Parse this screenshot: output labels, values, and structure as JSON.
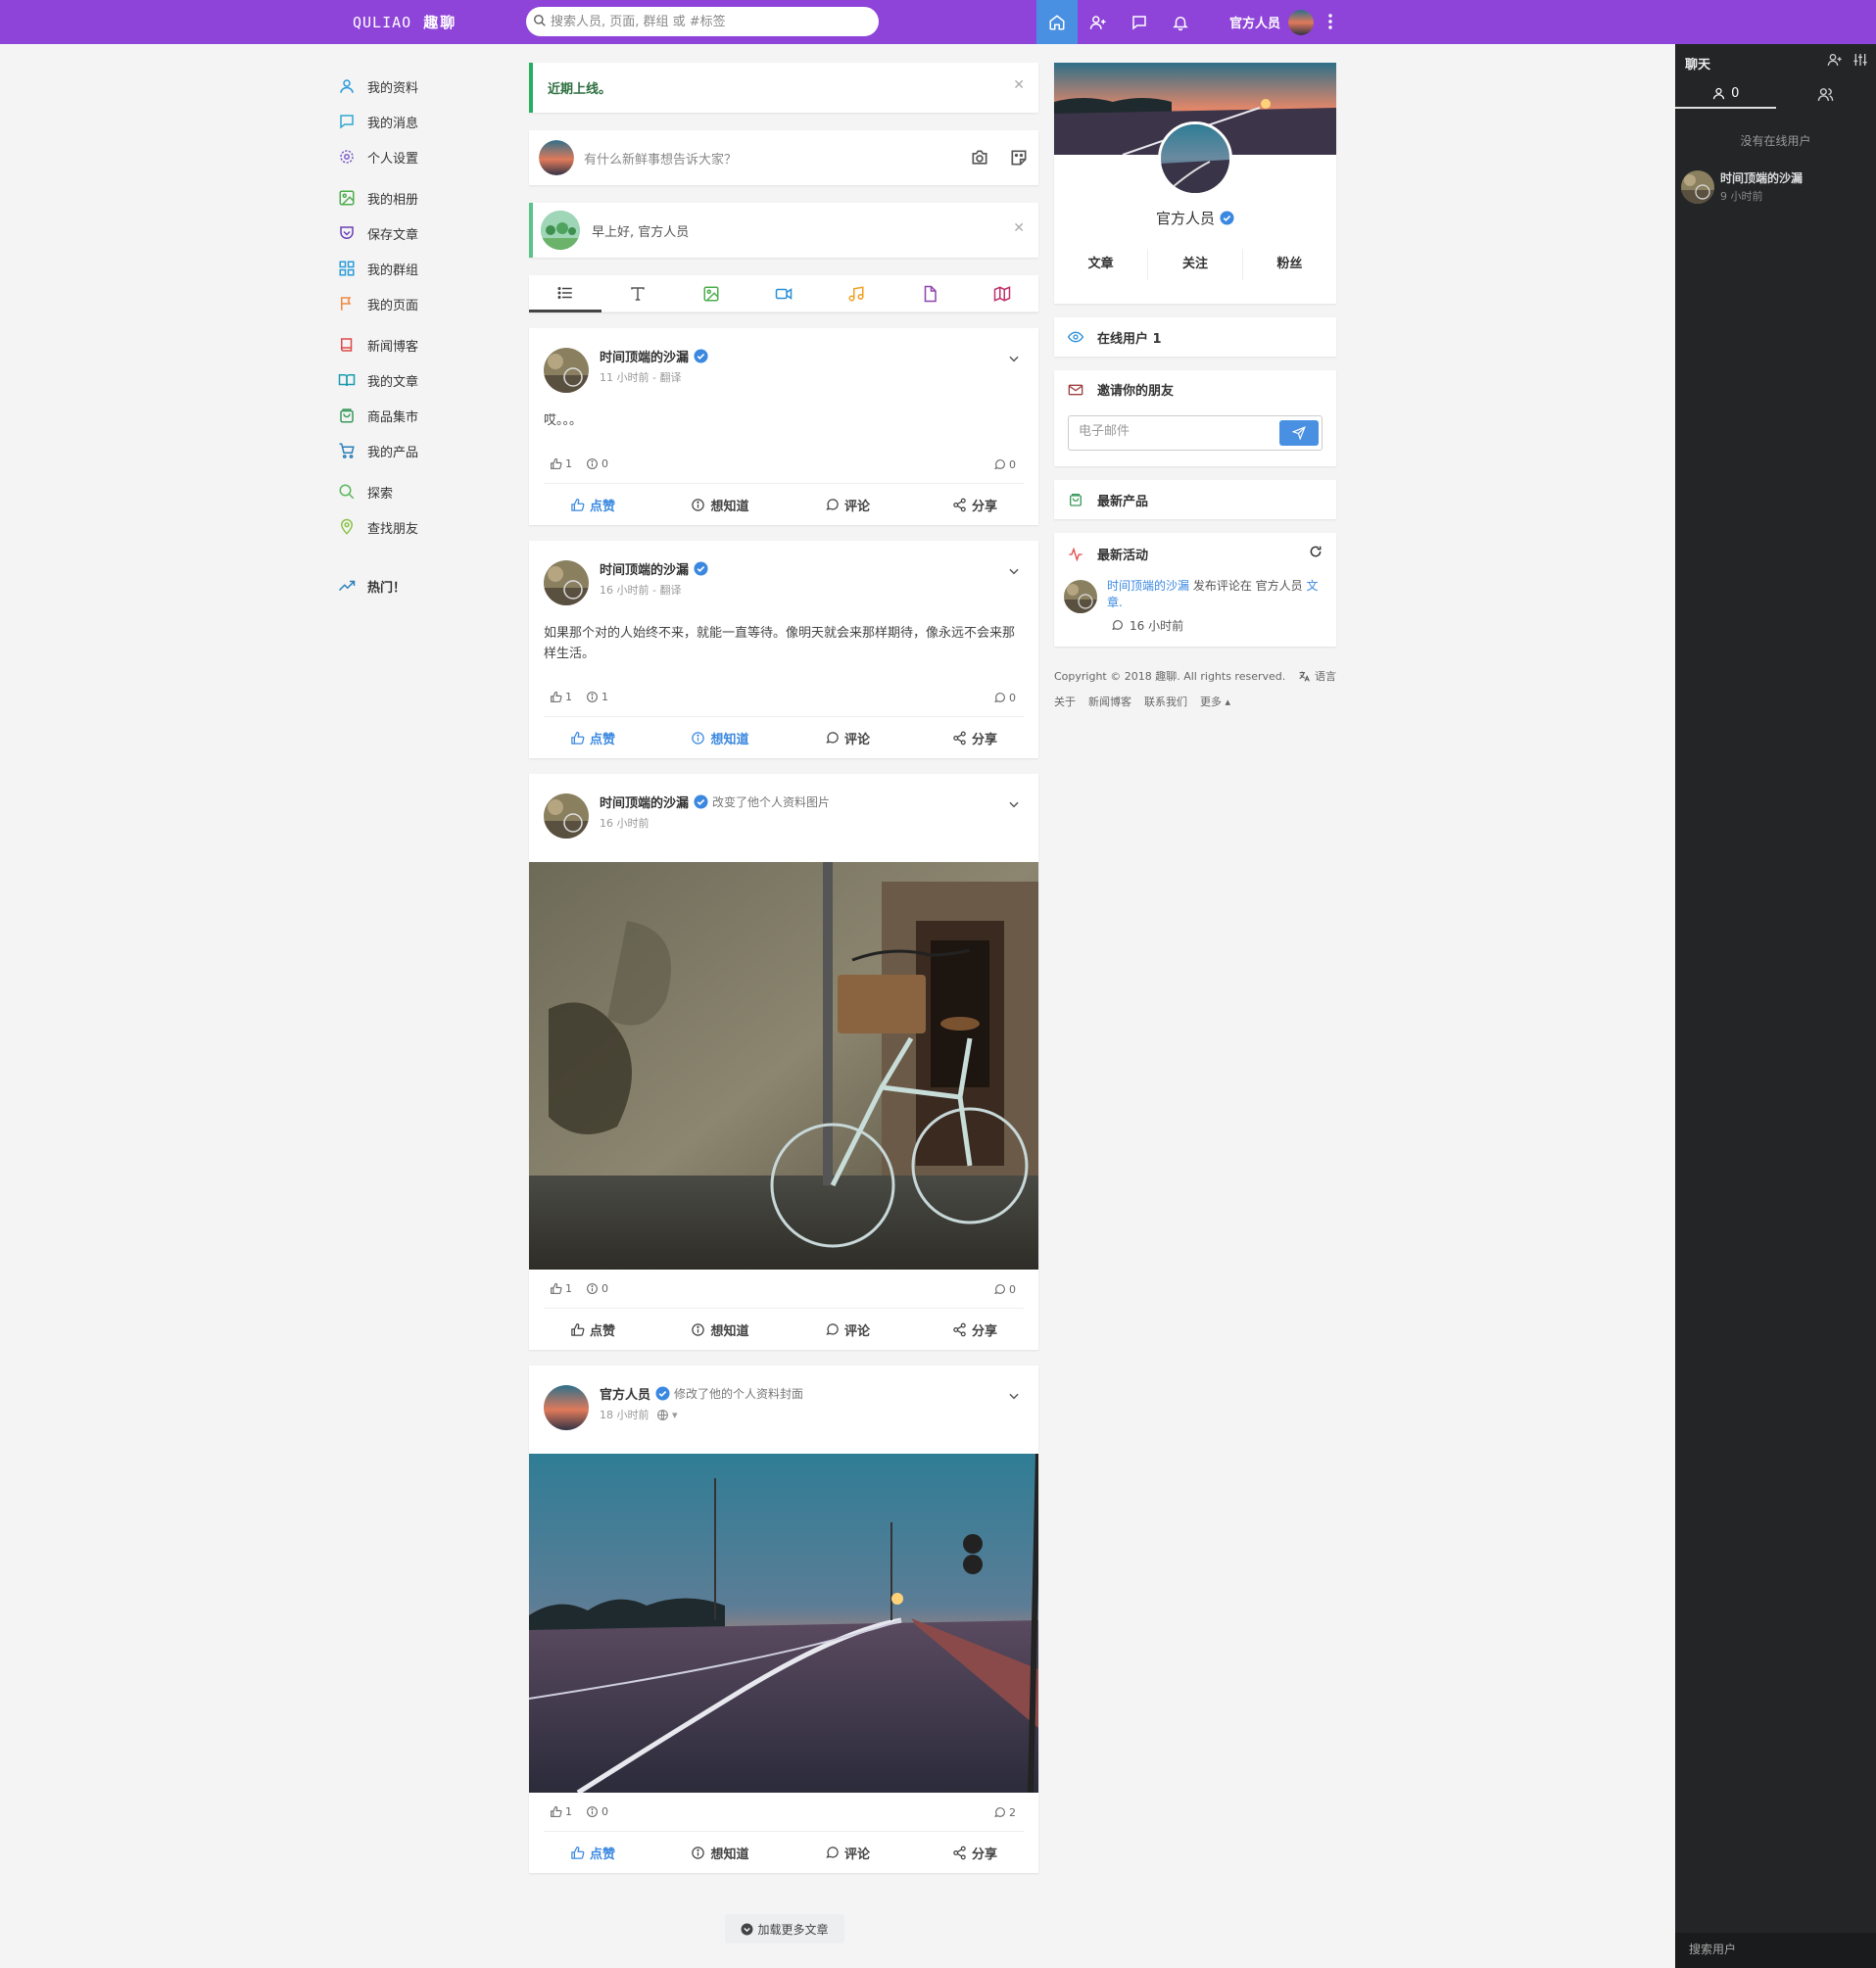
{
  "topbar": {
    "logo_latin": "QULIAO",
    "logo_cn": "趣聊",
    "search_placeholder": "搜索人员, 页面, 群组 或 #标签",
    "username": "官方人员",
    "bg_color": "#8e44d9",
    "active_color": "#4a90e2",
    "nav_icons": [
      "home-icon",
      "add-user-icon",
      "messages-icon",
      "notifications-icon"
    ]
  },
  "sidebar": {
    "items": [
      {
        "label": "我的资料",
        "icon": "user-icon"
      },
      {
        "label": "我的消息",
        "icon": "message-icon"
      },
      {
        "label": "个人设置",
        "icon": "gear-icon"
      },
      {
        "label": "我的相册",
        "icon": "image-icon"
      },
      {
        "label": "保存文章",
        "icon": "pocket-icon"
      },
      {
        "label": "我的群组",
        "icon": "grid-icon"
      },
      {
        "label": "我的页面",
        "icon": "flag-icon"
      },
      {
        "label": "新闻博客",
        "icon": "book-icon"
      },
      {
        "label": "我的文章",
        "icon": "open-book-icon"
      },
      {
        "label": "商品集市",
        "icon": "shopping-bag-icon"
      },
      {
        "label": "我的产品",
        "icon": "cart-icon"
      },
      {
        "label": "探索",
        "icon": "search-icon"
      },
      {
        "label": "查找朋友",
        "icon": "map-pin-icon"
      }
    ],
    "hot_label": "热门！"
  },
  "feed": {
    "announcement": "近期上线。",
    "composer_placeholder": "有什么新鲜事想告诉大家？",
    "greeting": "早上好, 官方人员",
    "filter_tabs": [
      "list-icon",
      "text-icon",
      "image-icon",
      "video-icon",
      "music-icon",
      "file-icon",
      "map-icon"
    ],
    "action_labels": {
      "like": "点赞",
      "wonder": "想知道",
      "comment": "评论",
      "share": "分享"
    },
    "posts": [
      {
        "author": "时间顶端的沙漏",
        "action": "",
        "time": "11 小时前",
        "translate": "翻译",
        "text": "哎。。。",
        "likes": "1",
        "wonders": "0",
        "comments": "0",
        "liked": true,
        "wondered": false
      },
      {
        "author": "时间顶端的沙漏",
        "action": "",
        "time": "16 小时前",
        "translate": "翻译",
        "text": "如果那个对的人始终不来，就能一直等待。像明天就会来那样期待，像永远不会来那样生活。",
        "likes": "1",
        "wonders": "1",
        "comments": "0",
        "liked": true,
        "wondered": true
      },
      {
        "author": "时间顶端的沙漏",
        "action": "改变了他个人资料图片",
        "time": "16 小时前",
        "likes": "1",
        "wonders": "0",
        "comments": "0",
        "liked": false,
        "wondered": false
      },
      {
        "author": "官方人员",
        "action": "修改了他的个人资料封面",
        "time": "18 小时前",
        "likes": "1",
        "wonders": "0",
        "comments": "2",
        "liked": true,
        "wondered": false
      }
    ],
    "load_more": "加载更多文章"
  },
  "profile": {
    "name": "官方人员",
    "stats": [
      "文章",
      "关注",
      "粉丝"
    ]
  },
  "widgets": {
    "online_users": "在线用户 1",
    "invite_title": "邀请你的朋友",
    "invite_placeholder": "电子邮件",
    "latest_products": "最新产品",
    "latest_activity": "最新活动",
    "activity": {
      "user": "时间顶端的沙漏",
      "verb": " 发布评论在 官方人员 ",
      "target": "文章",
      "tail": ".",
      "time": "16 小时前"
    }
  },
  "footer": {
    "copyright": "Copyright © 2018 趣聊. All rights reserved.",
    "language": "语言",
    "links": [
      "关于",
      "新闻博客",
      "联系我们",
      "更多 ▴"
    ]
  },
  "chat": {
    "title": "聊天",
    "online_count": "0",
    "no_online": "没有在线用户",
    "user_name": "时间顶端的沙漏",
    "user_time": "9 小时前",
    "search_placeholder": "搜索用户"
  }
}
